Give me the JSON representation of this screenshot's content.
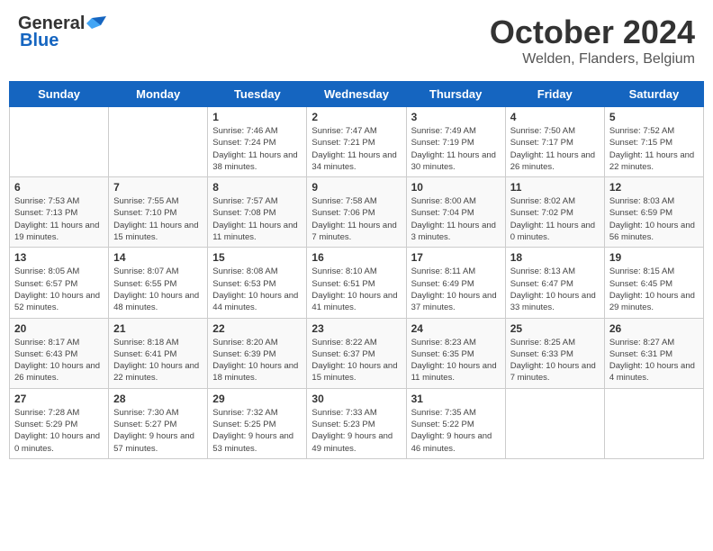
{
  "header": {
    "logo_general": "General",
    "logo_blue": "Blue",
    "title": "October 2024",
    "subtitle": "Welden, Flanders, Belgium"
  },
  "weekdays": [
    "Sunday",
    "Monday",
    "Tuesday",
    "Wednesday",
    "Thursday",
    "Friday",
    "Saturday"
  ],
  "weeks": [
    [
      {
        "day": "",
        "info": ""
      },
      {
        "day": "",
        "info": ""
      },
      {
        "day": "1",
        "info": "Sunrise: 7:46 AM\nSunset: 7:24 PM\nDaylight: 11 hours and 38 minutes."
      },
      {
        "day": "2",
        "info": "Sunrise: 7:47 AM\nSunset: 7:21 PM\nDaylight: 11 hours and 34 minutes."
      },
      {
        "day": "3",
        "info": "Sunrise: 7:49 AM\nSunset: 7:19 PM\nDaylight: 11 hours and 30 minutes."
      },
      {
        "day": "4",
        "info": "Sunrise: 7:50 AM\nSunset: 7:17 PM\nDaylight: 11 hours and 26 minutes."
      },
      {
        "day": "5",
        "info": "Sunrise: 7:52 AM\nSunset: 7:15 PM\nDaylight: 11 hours and 22 minutes."
      }
    ],
    [
      {
        "day": "6",
        "info": "Sunrise: 7:53 AM\nSunset: 7:13 PM\nDaylight: 11 hours and 19 minutes."
      },
      {
        "day": "7",
        "info": "Sunrise: 7:55 AM\nSunset: 7:10 PM\nDaylight: 11 hours and 15 minutes."
      },
      {
        "day": "8",
        "info": "Sunrise: 7:57 AM\nSunset: 7:08 PM\nDaylight: 11 hours and 11 minutes."
      },
      {
        "day": "9",
        "info": "Sunrise: 7:58 AM\nSunset: 7:06 PM\nDaylight: 11 hours and 7 minutes."
      },
      {
        "day": "10",
        "info": "Sunrise: 8:00 AM\nSunset: 7:04 PM\nDaylight: 11 hours and 3 minutes."
      },
      {
        "day": "11",
        "info": "Sunrise: 8:02 AM\nSunset: 7:02 PM\nDaylight: 11 hours and 0 minutes."
      },
      {
        "day": "12",
        "info": "Sunrise: 8:03 AM\nSunset: 6:59 PM\nDaylight: 10 hours and 56 minutes."
      }
    ],
    [
      {
        "day": "13",
        "info": "Sunrise: 8:05 AM\nSunset: 6:57 PM\nDaylight: 10 hours and 52 minutes."
      },
      {
        "day": "14",
        "info": "Sunrise: 8:07 AM\nSunset: 6:55 PM\nDaylight: 10 hours and 48 minutes."
      },
      {
        "day": "15",
        "info": "Sunrise: 8:08 AM\nSunset: 6:53 PM\nDaylight: 10 hours and 44 minutes."
      },
      {
        "day": "16",
        "info": "Sunrise: 8:10 AM\nSunset: 6:51 PM\nDaylight: 10 hours and 41 minutes."
      },
      {
        "day": "17",
        "info": "Sunrise: 8:11 AM\nSunset: 6:49 PM\nDaylight: 10 hours and 37 minutes."
      },
      {
        "day": "18",
        "info": "Sunrise: 8:13 AM\nSunset: 6:47 PM\nDaylight: 10 hours and 33 minutes."
      },
      {
        "day": "19",
        "info": "Sunrise: 8:15 AM\nSunset: 6:45 PM\nDaylight: 10 hours and 29 minutes."
      }
    ],
    [
      {
        "day": "20",
        "info": "Sunrise: 8:17 AM\nSunset: 6:43 PM\nDaylight: 10 hours and 26 minutes."
      },
      {
        "day": "21",
        "info": "Sunrise: 8:18 AM\nSunset: 6:41 PM\nDaylight: 10 hours and 22 minutes."
      },
      {
        "day": "22",
        "info": "Sunrise: 8:20 AM\nSunset: 6:39 PM\nDaylight: 10 hours and 18 minutes."
      },
      {
        "day": "23",
        "info": "Sunrise: 8:22 AM\nSunset: 6:37 PM\nDaylight: 10 hours and 15 minutes."
      },
      {
        "day": "24",
        "info": "Sunrise: 8:23 AM\nSunset: 6:35 PM\nDaylight: 10 hours and 11 minutes."
      },
      {
        "day": "25",
        "info": "Sunrise: 8:25 AM\nSunset: 6:33 PM\nDaylight: 10 hours and 7 minutes."
      },
      {
        "day": "26",
        "info": "Sunrise: 8:27 AM\nSunset: 6:31 PM\nDaylight: 10 hours and 4 minutes."
      }
    ],
    [
      {
        "day": "27",
        "info": "Sunrise: 7:28 AM\nSunset: 5:29 PM\nDaylight: 10 hours and 0 minutes."
      },
      {
        "day": "28",
        "info": "Sunrise: 7:30 AM\nSunset: 5:27 PM\nDaylight: 9 hours and 57 minutes."
      },
      {
        "day": "29",
        "info": "Sunrise: 7:32 AM\nSunset: 5:25 PM\nDaylight: 9 hours and 53 minutes."
      },
      {
        "day": "30",
        "info": "Sunrise: 7:33 AM\nSunset: 5:23 PM\nDaylight: 9 hours and 49 minutes."
      },
      {
        "day": "31",
        "info": "Sunrise: 7:35 AM\nSunset: 5:22 PM\nDaylight: 9 hours and 46 minutes."
      },
      {
        "day": "",
        "info": ""
      },
      {
        "day": "",
        "info": ""
      }
    ]
  ]
}
